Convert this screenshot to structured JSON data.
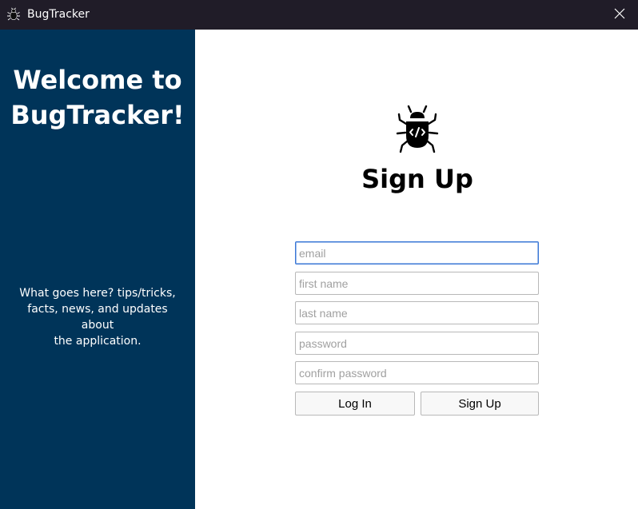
{
  "window": {
    "title": "BugTracker",
    "app_icon": "bug-icon",
    "close_icon": "close-icon"
  },
  "sidebar": {
    "welcome": "Welcome to\nBugTracker!",
    "blurb": "What goes here? tips/tricks,\nfacts, news, and updates about\nthe application.",
    "background_color": "#003459"
  },
  "main": {
    "logo_icon": "bug-code-icon",
    "heading": "Sign Up",
    "form": {
      "email": {
        "placeholder": "email",
        "value": ""
      },
      "first_name": {
        "placeholder": "first name",
        "value": ""
      },
      "last_name": {
        "placeholder": "last name",
        "value": ""
      },
      "password": {
        "placeholder": "password",
        "value": ""
      },
      "confirm_password": {
        "placeholder": "confirm password",
        "value": ""
      }
    },
    "buttons": {
      "login_label": "Log In",
      "signup_label": "Sign Up"
    }
  }
}
